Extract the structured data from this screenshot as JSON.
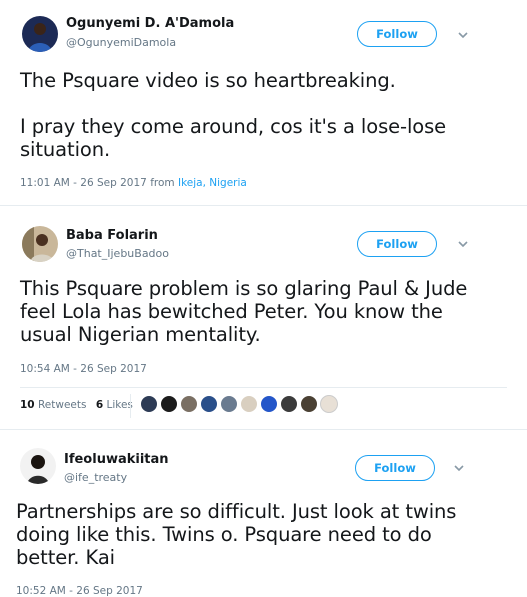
{
  "tweets": [
    {
      "name": "Ogunyemi D. A'Damola",
      "handle": "@OgunyemiDamola",
      "follow_label": "Follow",
      "text_paragraphs": [
        "The Psquare video is so heartbreaking.",
        "I pray they come around, cos it's a lose-lose situation."
      ],
      "timestamp": "11:01 AM - 26 Sep 2017 from ",
      "location": "Ikeja, Nigeria"
    },
    {
      "name": "Baba Folarin",
      "handle": "@That_IjebuBadoo",
      "follow_label": "Follow",
      "text_paragraphs": [
        "This Psquare problem is so glaring Paul & Jude feel Lola has bewitched Peter. You know the usual Nigerian mentality."
      ],
      "timestamp": "10:54 AM - 26 Sep 2017",
      "retweets_count": "10",
      "retweets_label": "Retweets",
      "likes_count": "6",
      "likes_label": "Likes"
    },
    {
      "name": "Ifeoluwakiitan",
      "handle": "@ife_treaty",
      "follow_label": "Follow",
      "text_paragraphs": [
        "Partnerships are so difficult. Just look at twins doing like this. Twins o. Psquare need to do better. Kai"
      ],
      "timestamp": "10:52 AM - 26 Sep 2017"
    }
  ],
  "colors": {
    "accent": "#1da1f2",
    "secondary_text": "#657786",
    "divider": "#e6ecf0"
  }
}
